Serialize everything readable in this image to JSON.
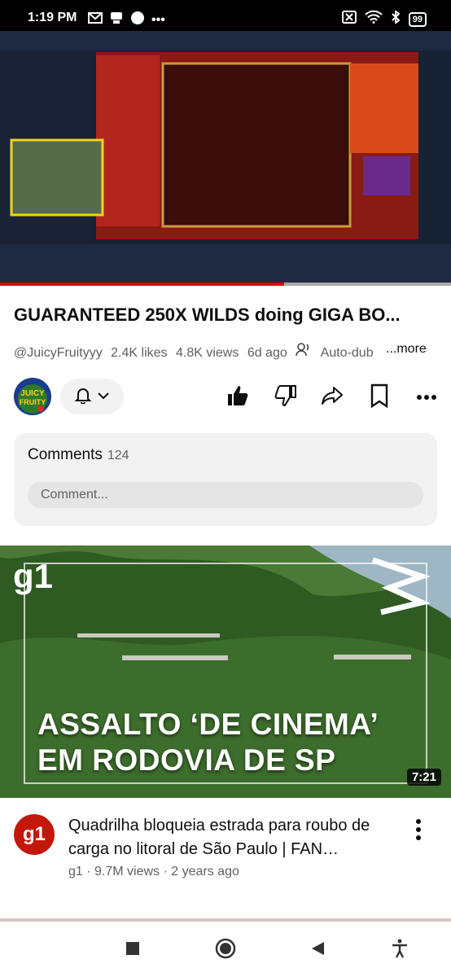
{
  "status": {
    "time": "1:19 PM",
    "battery": "99"
  },
  "video": {
    "title": "GUARANTEED 250X WILDS doing GIGA BO...",
    "channel": "@JuicyFruityyy",
    "likes": "2.4K likes",
    "views": "4.8K views",
    "age": "6d ago",
    "dub": "Auto-dub",
    "more": "...more",
    "progress_fraction": 0.63,
    "avatar_text": "JUICY FRUITY"
  },
  "comments": {
    "label": "Comments",
    "count": "124",
    "placeholder": "Comment..."
  },
  "next_video": {
    "thumb_logo": "g1",
    "thumb_line1": "ASSALTO ‘DE CINEMA’",
    "thumb_line2": "EM RODOVIA DE SP",
    "duration": "7:21",
    "channel_avatar": "g1",
    "title": "Quadrilha bloqueia estrada para roubo de carga no litoral de São Paulo | FAN…",
    "meta": "g1 · 9.7M views · 2 years ago"
  },
  "colors": {
    "accent": "#e60000",
    "g1_red": "#c4170c"
  }
}
